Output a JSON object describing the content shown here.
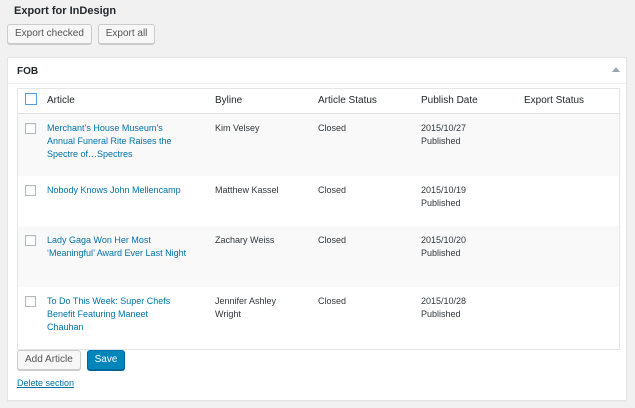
{
  "page": {
    "title": "Export for InDesign"
  },
  "top_actions": {
    "export_checked": "Export checked",
    "export_all": "Export all"
  },
  "section": {
    "title": "FOB",
    "delete_label": "Delete section"
  },
  "table": {
    "headers": [
      "Article",
      "Byline",
      "Article Status",
      "Publish Date",
      "Export Status"
    ],
    "rows": [
      {
        "article": "Merchant’s House Museum’s Annual Funeral Rite Raises the Spectre of…Spectres",
        "byline": "Kim Velsey",
        "status": "Closed",
        "date": "2015/10/27",
        "pub": "Published",
        "export": ""
      },
      {
        "article": "Nobody Knows John Mellencamp",
        "byline": "Matthew Kassel",
        "status": "Closed",
        "date": "2015/10/19",
        "pub": "Published",
        "export": ""
      },
      {
        "article": "Lady Gaga Won Her Most ‘Meaningful’ Award Ever Last Night",
        "byline": "Zachary Weiss",
        "status": "Closed",
        "date": "2015/10/20",
        "pub": "Published",
        "export": ""
      },
      {
        "article": "To Do This Week: Super Chefs Benefit Featuring Maneet Chauhan",
        "byline": "Jennifer Ashley Wright",
        "status": "Closed",
        "date": "2015/10/28",
        "pub": "Published",
        "export": ""
      }
    ]
  },
  "bottom_actions": {
    "add_article": "Add Article",
    "save": "Save"
  },
  "colors": {
    "link": "#0073aa",
    "primary": "#0085ba",
    "background": "#f1f1f1"
  },
  "icons": {
    "toggle": "triangle-up-icon"
  }
}
